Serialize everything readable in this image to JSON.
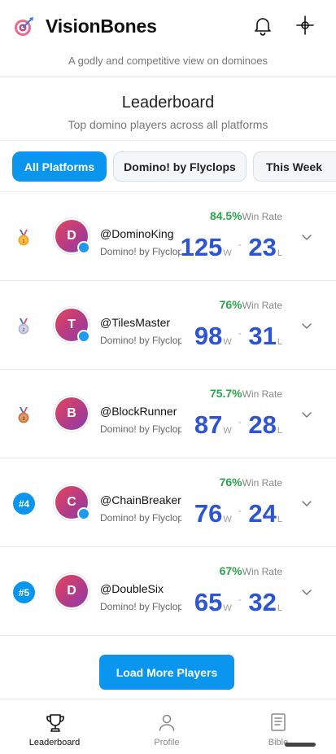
{
  "app": {
    "title": "VisionBones",
    "tagline": "A godly and competitive view on dominoes"
  },
  "leaderboard": {
    "title": "Leaderboard",
    "subtitle": "Top domino players across all platforms"
  },
  "filters": [
    {
      "label": "All Platforms",
      "active": true
    },
    {
      "label": "Domino! by Flyclops",
      "active": false
    },
    {
      "label": "This Week",
      "active": false
    }
  ],
  "players": [
    {
      "rank_icon": "gold-medal-icon",
      "rank_label": "",
      "initial": "D",
      "username": "@DominoKing",
      "platform": "Domino! by Flyclops",
      "win_rate": "84.5%",
      "win_rate_label": "Win Rate",
      "wins": "125",
      "losses": "23",
      "w": "W",
      "l": "L",
      "online": true
    },
    {
      "rank_icon": "silver-medal-icon",
      "rank_label": "",
      "initial": "T",
      "username": "@TilesMaster",
      "platform": "Domino! by Flyclops",
      "win_rate": "76%",
      "win_rate_label": "Win Rate",
      "wins": "98",
      "losses": "31",
      "w": "W",
      "l": "L",
      "online": true
    },
    {
      "rank_icon": "bronze-medal-icon",
      "rank_label": "",
      "initial": "B",
      "username": "@BlockRunner",
      "platform": "Domino! by Flyclops",
      "win_rate": "75.7%",
      "win_rate_label": "Win Rate",
      "wins": "87",
      "losses": "28",
      "w": "W",
      "l": "L",
      "online": false
    },
    {
      "rank_icon": "",
      "rank_label": "#4",
      "initial": "C",
      "username": "@ChainBreaker",
      "platform": "Domino! by Flyclops",
      "win_rate": "76%",
      "win_rate_label": "Win Rate",
      "wins": "76",
      "losses": "24",
      "w": "W",
      "l": "L",
      "online": true
    },
    {
      "rank_icon": "",
      "rank_label": "#5",
      "initial": "D",
      "username": "@DoubleSix",
      "platform": "Domino! by Flyclops",
      "win_rate": "67%",
      "win_rate_label": "Win Rate",
      "wins": "65",
      "losses": "32",
      "w": "W",
      "l": "L",
      "online": false
    }
  ],
  "load_more": "Load More Players",
  "nav": {
    "leaderboard": "Leaderboard",
    "profile": "Profile",
    "bible": "Bible"
  },
  "colors": {
    "accent": "#0a96ee",
    "score": "#2d54d4",
    "win_rate": "#2aa44a"
  }
}
